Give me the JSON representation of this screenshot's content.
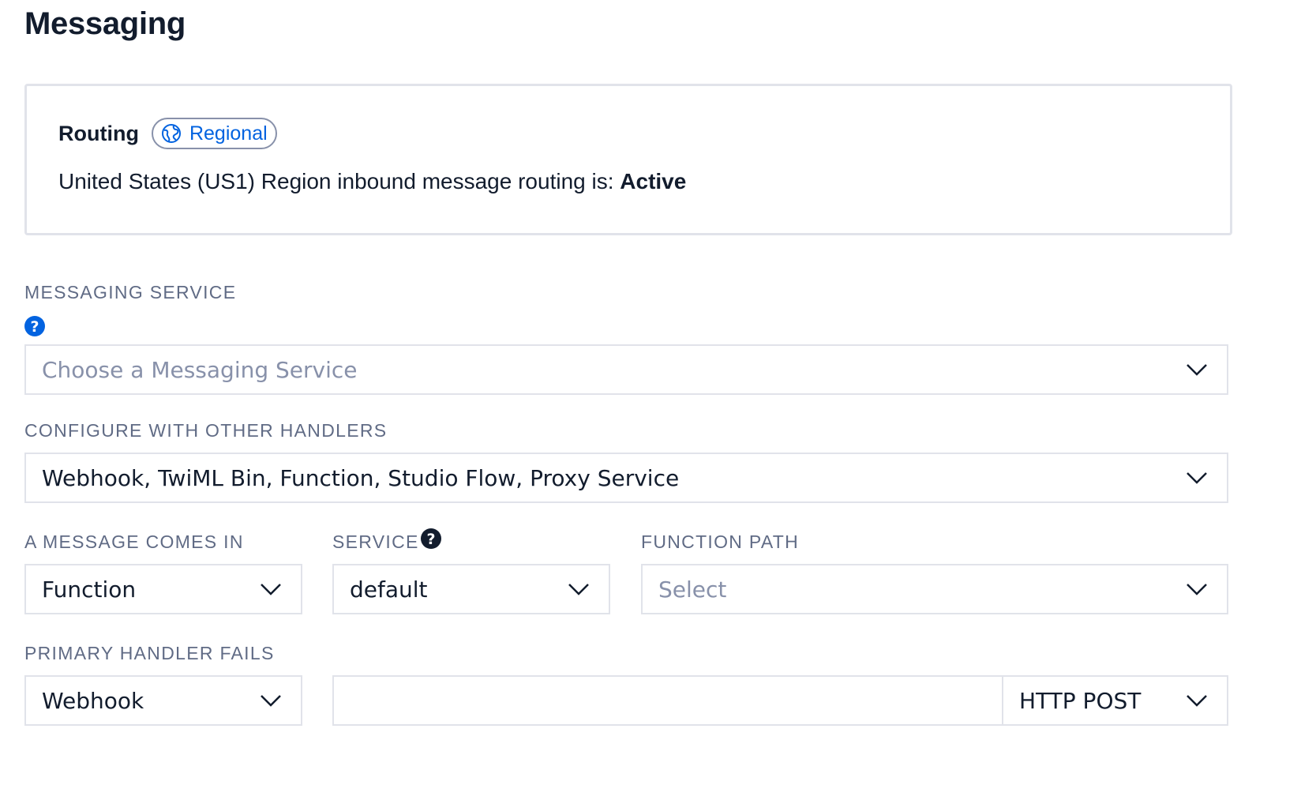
{
  "page": {
    "title": "Messaging"
  },
  "routing": {
    "title": "Routing",
    "badge": "Regional",
    "status_prefix": "United States (US1) Region inbound message routing is: ",
    "status_value": "Active"
  },
  "messaging_service": {
    "label": "MESSAGING SERVICE",
    "placeholder": "Choose a Messaging Service"
  },
  "other_handlers": {
    "label": "CONFIGURE WITH OTHER HANDLERS",
    "value": "Webhook, TwiML Bin, Function, Studio Flow, Proxy Service"
  },
  "message_comes_in": {
    "label": "A MESSAGE COMES IN",
    "value": "Function"
  },
  "service": {
    "label": "SERVICE",
    "value": "default"
  },
  "function_path": {
    "label": "FUNCTION PATH",
    "placeholder": "Select"
  },
  "primary_handler_fails": {
    "label": "PRIMARY HANDLER FAILS",
    "value": "Webhook",
    "url_value": "",
    "method": "HTTP POST"
  },
  "colors": {
    "accent": "#0263e0",
    "text": "#121c2d",
    "label": "#606b85",
    "border": "#e1e3ea"
  }
}
